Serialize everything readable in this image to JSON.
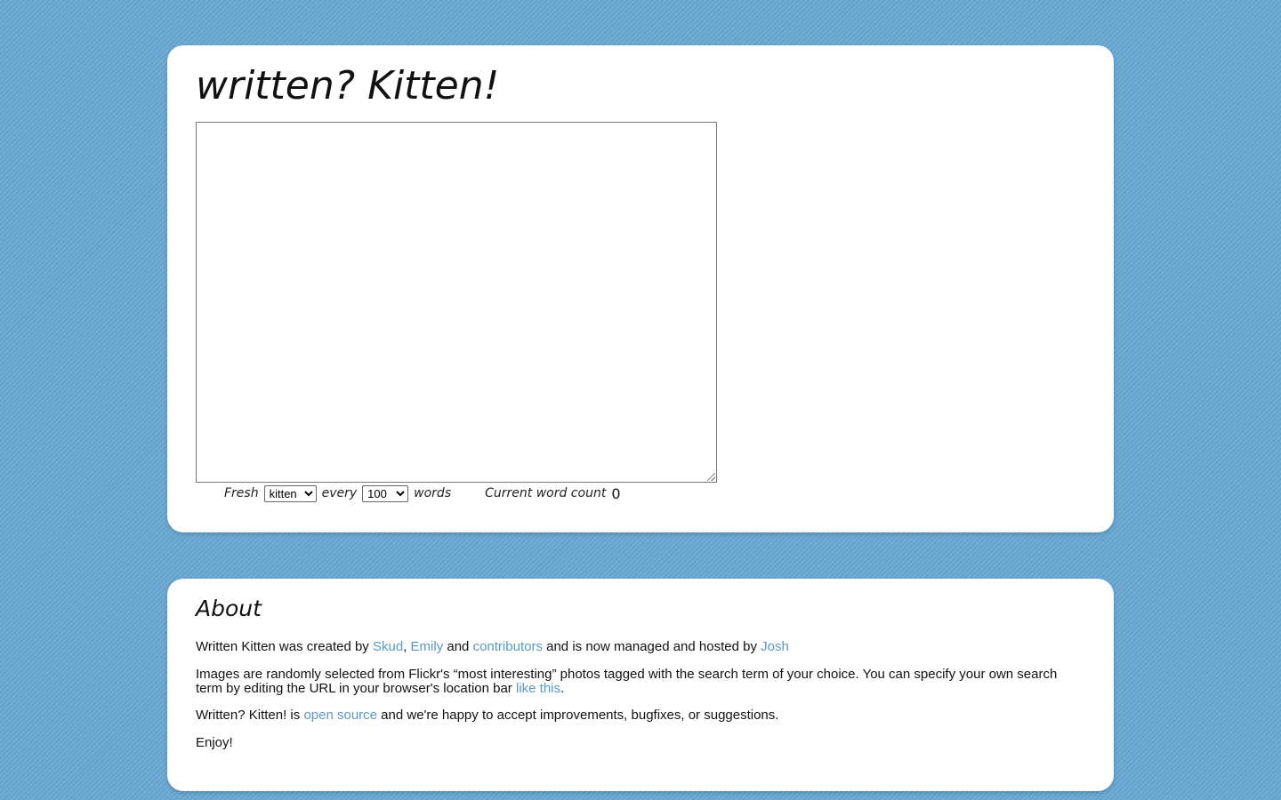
{
  "header": {
    "title": "written? Kitten!"
  },
  "writer": {
    "textarea_value": "",
    "controls": {
      "fresh_label": "Fresh",
      "tag_options": [
        "kitten"
      ],
      "tag_selected": "kitten",
      "every_label": "every",
      "interval_options": [
        "100"
      ],
      "interval_selected": "100",
      "words_label": "words",
      "word_count_label": "Current word count",
      "word_count_value": "0"
    }
  },
  "about": {
    "heading": "About",
    "credits": {
      "prefix": "Written Kitten was created by ",
      "skud": "Skud",
      "sep1": ", ",
      "emily": "Emily",
      "and": " and ",
      "contributors": "contributors",
      "middle": " and is now managed and hosted by ",
      "josh": "Josh"
    },
    "images": {
      "text": "Images are randomly selected from Flickr's “most interesting” photos tagged with the search term of your choice. You can specify your own search term by editing the URL in your browser's location bar ",
      "link": "like this",
      "end": "."
    },
    "opensource": {
      "prefix": "Written? Kitten! is ",
      "link": "open source",
      "suffix": " and we're happy to accept improvements, bugfixes, or suggestions."
    },
    "enjoy": "Enjoy!"
  },
  "colors": {
    "background": "#67a7d3",
    "card": "#ffffff",
    "link": "#5a98c1"
  }
}
